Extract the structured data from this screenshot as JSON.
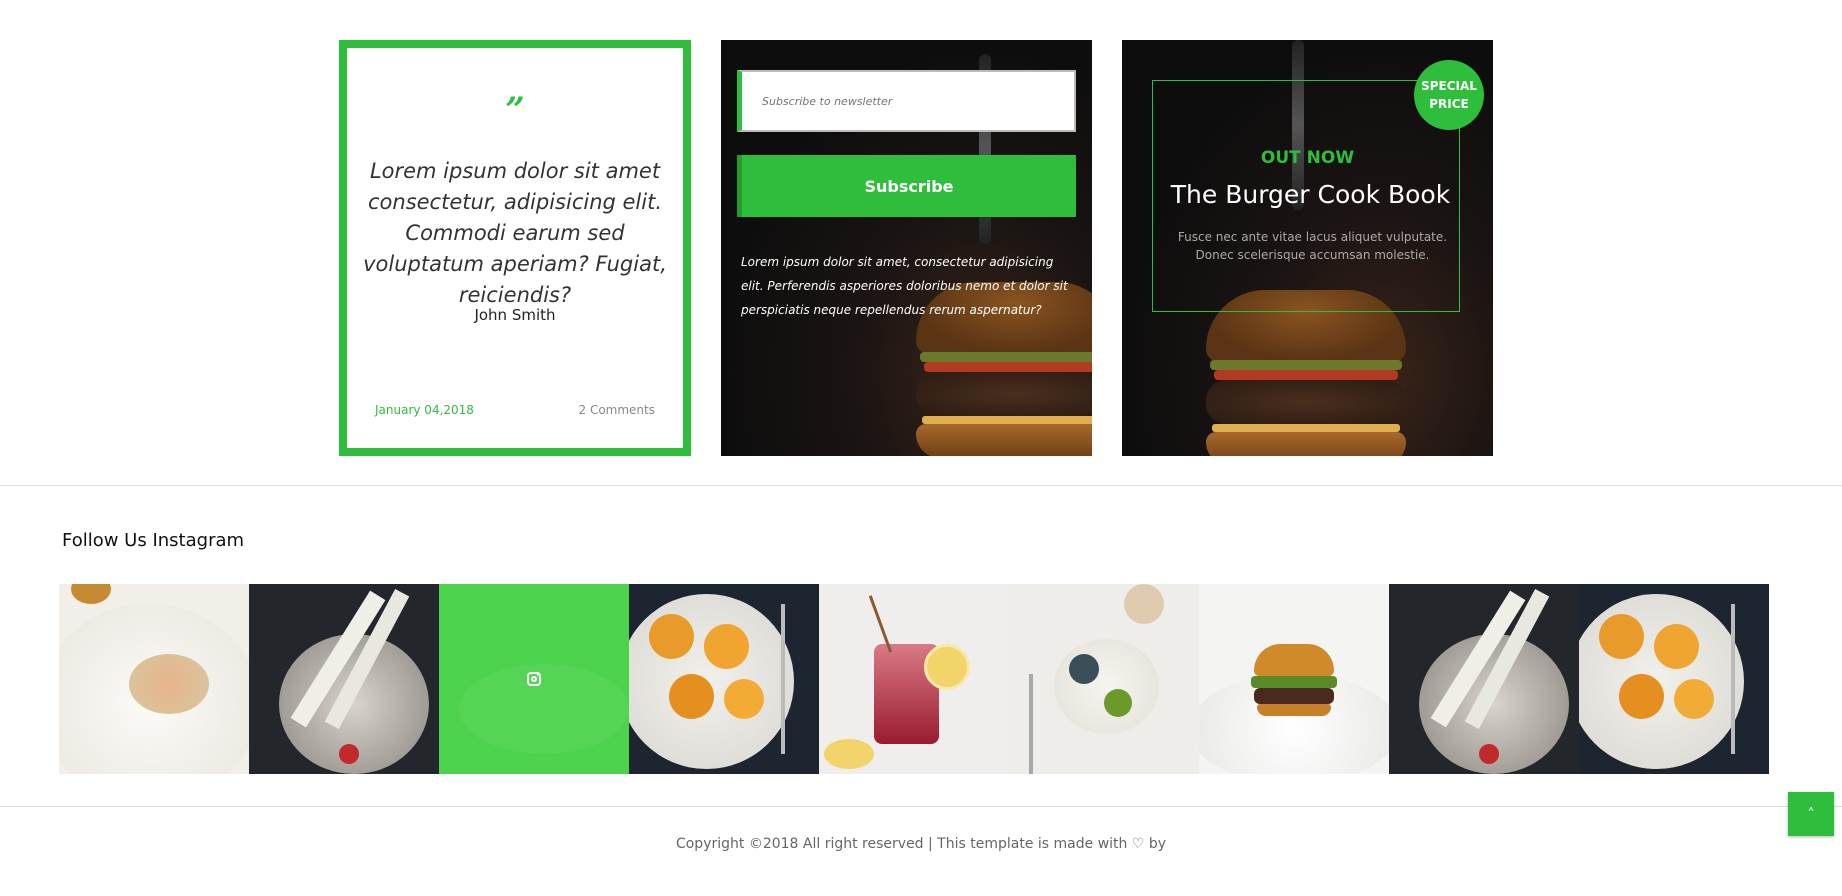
{
  "quote_card": {
    "quote_mark": "”",
    "text": "Lorem ipsum dolor sit amet consectetur, adipisicing elit. Commodi earum sed voluptatum aperiam? Fugiat, reiciendis?",
    "author": "John Smith",
    "date": "January 04,2018",
    "comments": "2 Comments"
  },
  "newsletter_card": {
    "input_placeholder": "Subscribe to newsletter",
    "button_label": "Subscribe",
    "text": "Lorem ipsum dolor sit amet, consectetur adipisicing elit. Perferendis asperiores doloribus nemo et dolor sit perspiciatis neque repellendus rerum aspernatur?"
  },
  "book_card": {
    "badge": "SPECIAL PRICE",
    "eyebrow": "OUT NOW",
    "title": "The Burger Cook Book",
    "description": "Fusce nec ante vitae lacus aliquet vulputate. Donec scelerisque accumsan molestie."
  },
  "instagram": {
    "title": "Follow Us Instagram",
    "tiles": [
      "dish-cream-plate",
      "noodle-bowl-dark",
      "instagram-overlay",
      "orange-plate-dark",
      "berry-smoothie-jar",
      "fruit-yogurt-bowl",
      "burger-white",
      "noodle-bowl-dark",
      "orange-plate-dark"
    ]
  },
  "footer": {
    "copyright": "Copyright ©2018 All right reserved | This template is made with ♡ by"
  },
  "back_to_top": {
    "icon": "chevron-up-icon",
    "glyph": "˄"
  },
  "colors": {
    "accent": "#2fbd3c",
    "instagram_hover": "#4cd24c",
    "dark": "#0e0d0d"
  }
}
